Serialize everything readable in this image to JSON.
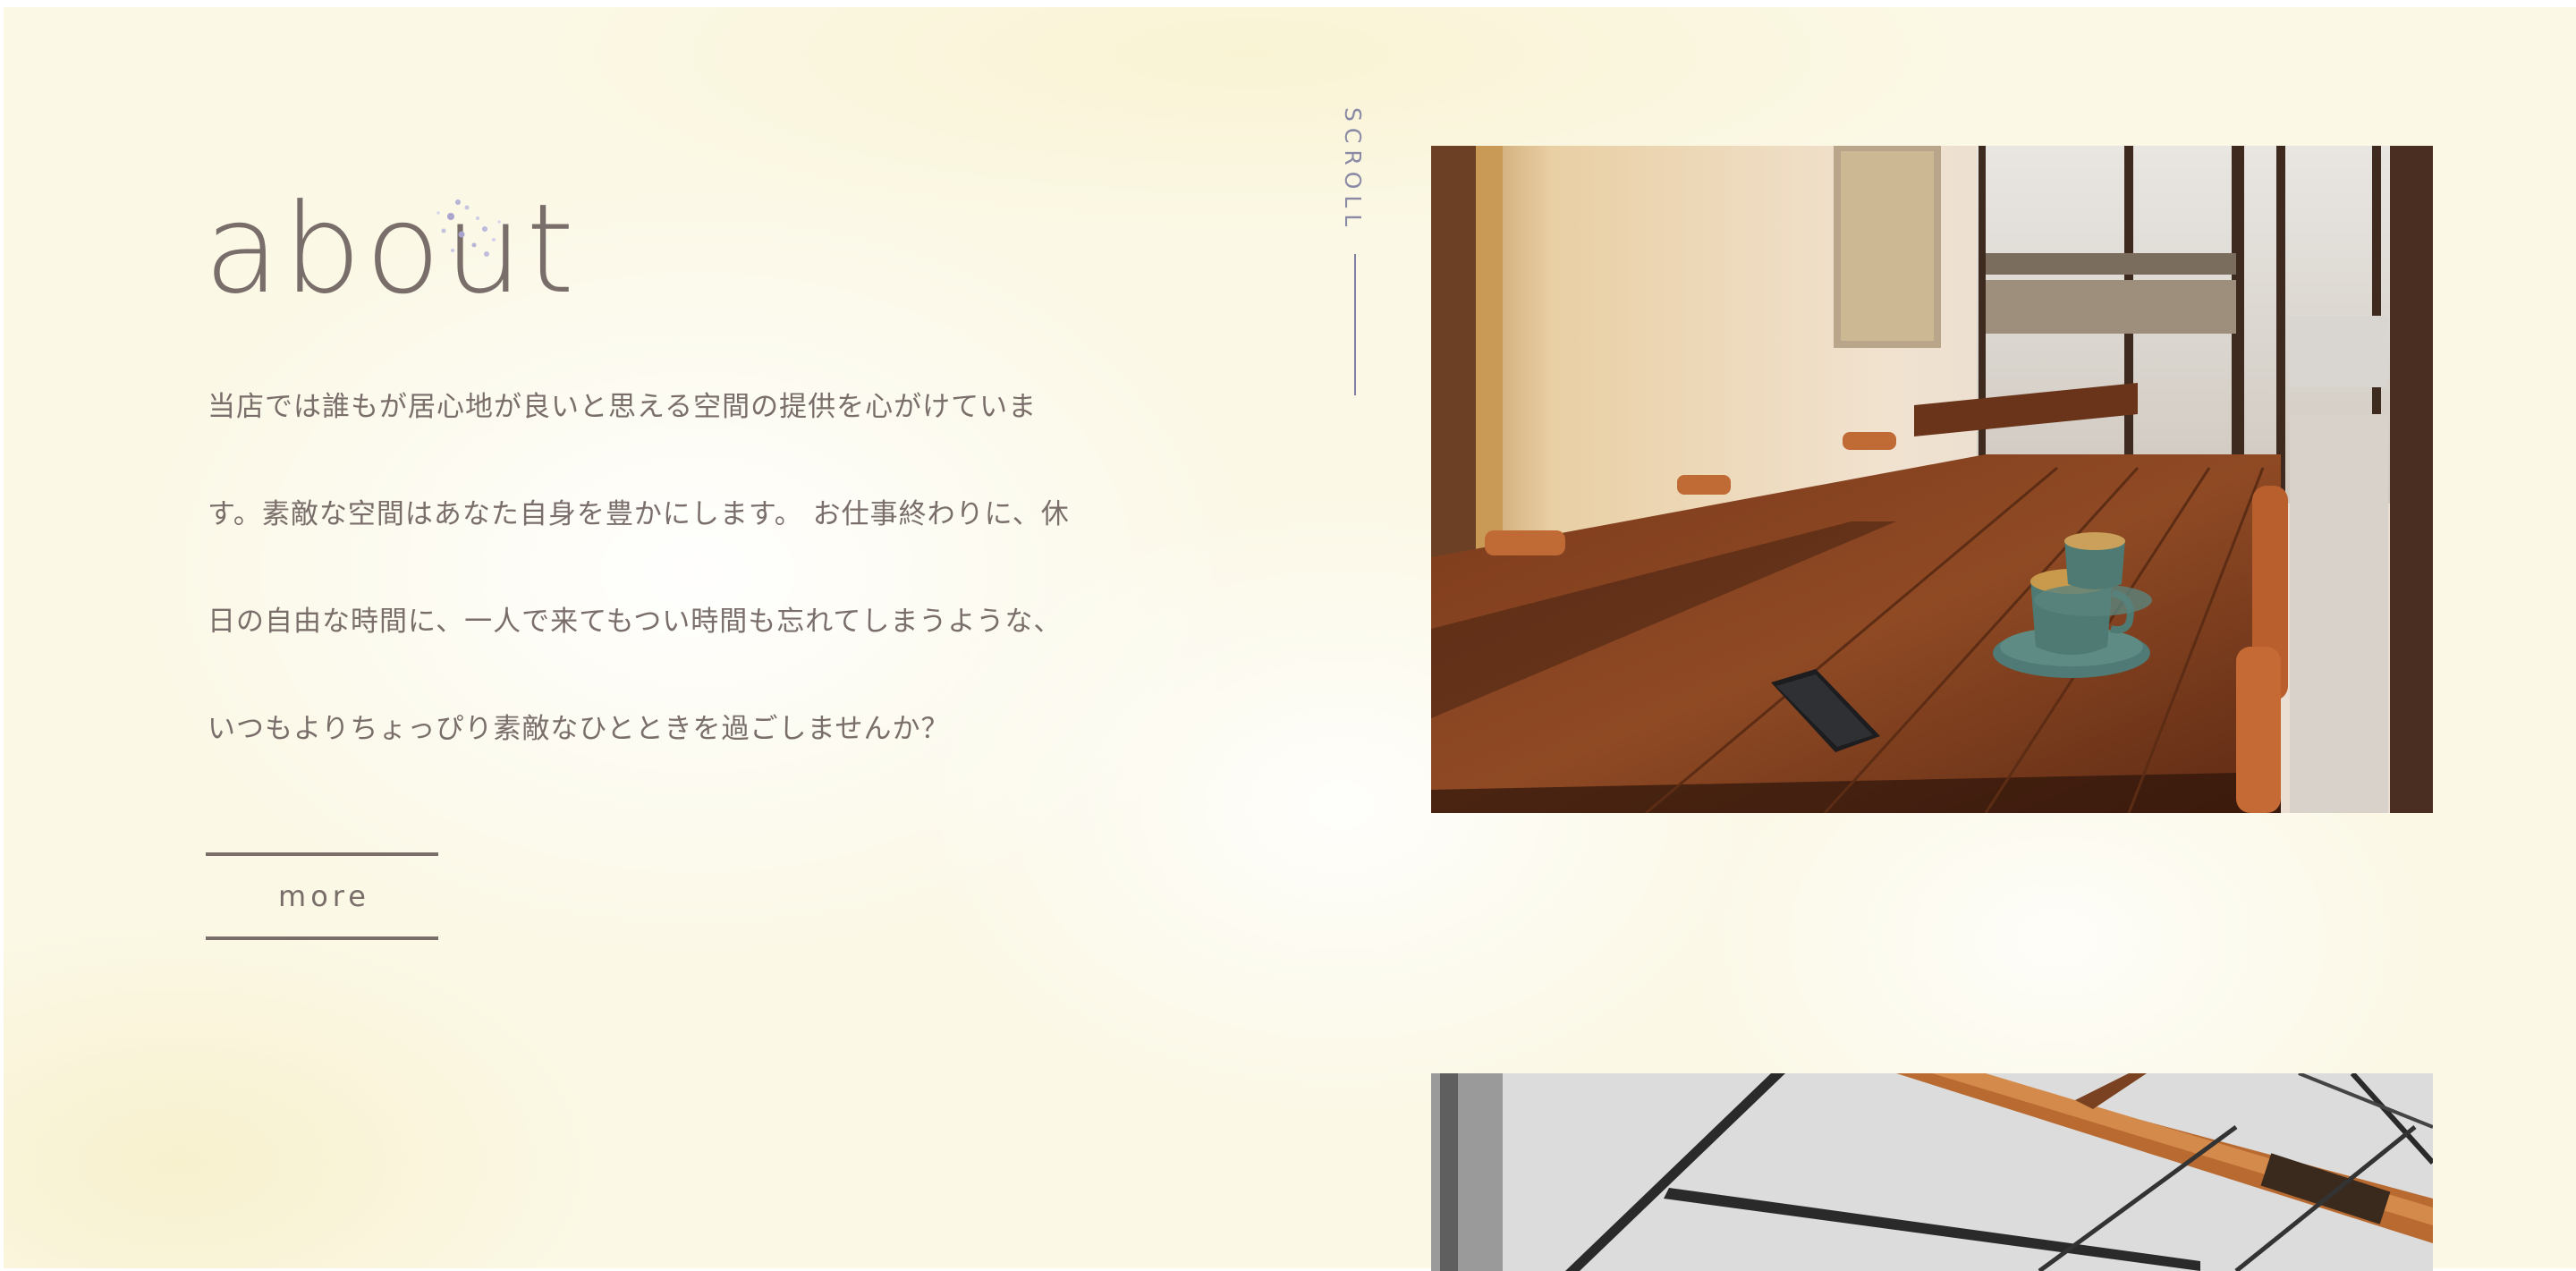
{
  "about": {
    "title": "about",
    "paragraph_lines": [
      "当店では誰もが居心地が良いと思える空間の提供を心がけていま",
      "す。素敵な空間はあなた自身を豊かにします。 お仕事終わりに、休",
      "日の自由な時間に、一人で来てもつい時間も忘れてしまうような、",
      "いつもよりちょっぴり素敵なひとときを過ごしませんか？"
    ],
    "more_label": "more"
  },
  "scroll": {
    "label": "SCROLL"
  },
  "images": {
    "cafe_photo": "cafe-interior-table-with-coffee-cups",
    "ceiling_photo": "industrial-ceiling-beams"
  },
  "colors": {
    "background": "#fbf8e6",
    "text": "#7a6e6b",
    "scroll_accent": "#7e7ea0"
  }
}
